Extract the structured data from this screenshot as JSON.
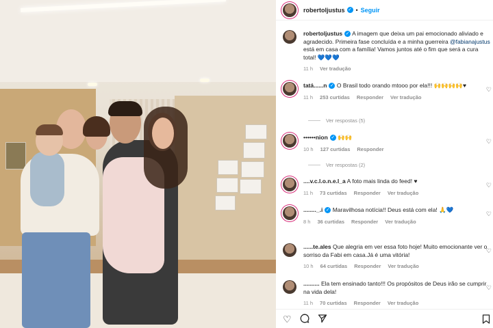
{
  "post": {
    "username": "robertoljustus",
    "dot": "•",
    "follow_label": "Seguir",
    "caption_user": "robertoljustus",
    "caption_before_mention": "A imagem que deixa um pai emocionado aliviado e agradecido. Primeira fase concluída e a minha guerreira",
    "caption_mention": "@fabianajustus",
    "caption_after_mention": "está em casa com a família! Vamos juntos até o fim que será a cura total! 💙💙💙",
    "caption_time": "11 h",
    "caption_translate": "Ver tradução"
  },
  "comments": [
    {
      "user": "tatá......n",
      "text": "O Brasil todo orando mtooo por ela!!! 🙌🙌🙌🙌♥",
      "time": "11 h",
      "likes": "253 curtidas",
      "reply": "Responder",
      "translate": "Ver tradução",
      "view_replies": "Ver respostas (5)"
    },
    {
      "user": "••••••nion",
      "text": "🙌🙌",
      "time": "10 h",
      "likes": "127 curtidas",
      "reply": "Responder",
      "view_replies": "Ver respostas (2)"
    },
    {
      "user": "....v.c.l.o.n.e.l_a",
      "text": "A foto mais linda do feed! ♥",
      "time": "11 h",
      "likes": "73 curtidas",
      "reply": "Responder",
      "translate": "Ver tradução"
    },
    {
      "user": "........_.i",
      "text": "Maravilhosa notícia!! Deus está com ela! 🙏💙",
      "time": "8 h",
      "likes": "36 curtidas",
      "reply": "Responder",
      "translate": "Ver tradução"
    },
    {
      "user": "......te.ales",
      "text": "Que alegria em ver essa foto hoje! Muito emocionante ver o sorriso da Fabi em casa.Já é uma vitória!",
      "time": "10 h",
      "likes": "64 curtidas",
      "reply": "Responder",
      "translate": "Ver tradução"
    },
    {
      "user": "..........",
      "text": "Ela tem ensinado tanto!!! Os propósitos de Deus irão se cumprir na vida dela!",
      "time": "11 h",
      "likes": "70 curtidas",
      "reply": "Responder",
      "translate": "Ver tradução"
    }
  ],
  "icons": {
    "like": "heart-icon",
    "comment": "comment-icon",
    "share": "share-icon",
    "save": "bookmark-icon"
  },
  "colors": {
    "accent": "#0095f6",
    "verified": "#0095f6",
    "muted": "#8e8e8e"
  }
}
